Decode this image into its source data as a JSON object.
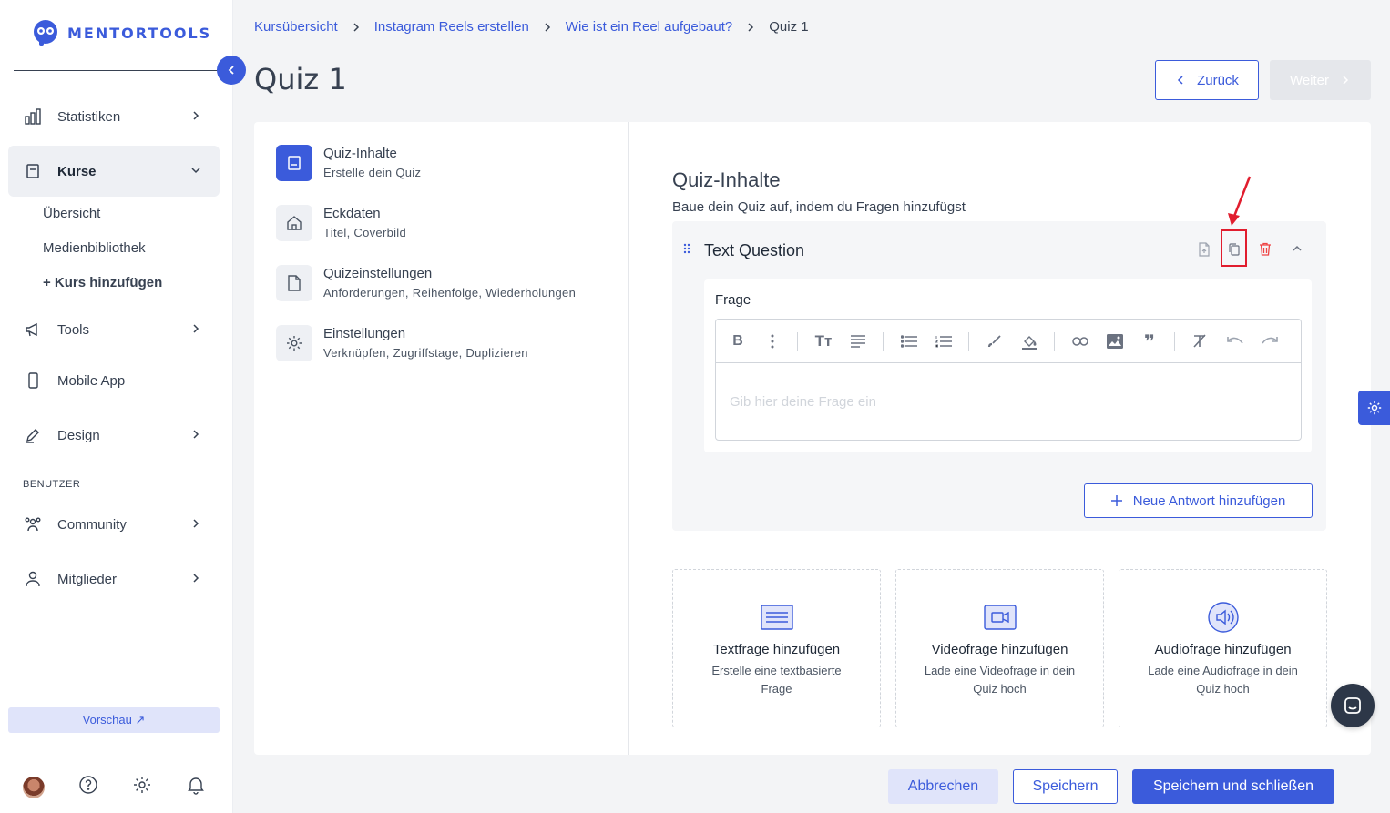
{
  "brand": {
    "name": "MENTORTOOLS",
    "accent": "#3b5bdb"
  },
  "sidebar": {
    "items": [
      {
        "label": "Statistiken",
        "icon": "bar-chart-icon"
      },
      {
        "label": "Kurse",
        "icon": "book-icon",
        "active": true
      },
      {
        "label": "Tools",
        "icon": "megaphone-icon"
      },
      {
        "label": "Mobile App",
        "icon": "phone-icon"
      },
      {
        "label": "Design",
        "icon": "pen-icon"
      },
      {
        "label": "Community",
        "icon": "people-icon"
      },
      {
        "label": "Mitglieder",
        "icon": "user-icon"
      }
    ],
    "sub_items": [
      {
        "label": "Übersicht"
      },
      {
        "label": "Medienbibliothek"
      },
      {
        "label": "+ Kurs hinzufügen"
      }
    ],
    "section_label": "BENUTZER",
    "preview_label": "Vorschau ↗"
  },
  "breadcrumb": {
    "items": [
      "Kursübersicht",
      "Instagram Reels erstellen",
      "Wie ist ein Reel aufgebaut?"
    ],
    "current": "Quiz 1"
  },
  "page": {
    "title": "Quiz 1",
    "back_label": "Zurück",
    "next_label": "Weiter"
  },
  "steps": [
    {
      "title": "Quiz-Inhalte",
      "sub": "Erstelle dein Quiz",
      "icon": "book-icon"
    },
    {
      "title": "Eckdaten",
      "sub": "Titel, Coverbild",
      "icon": "home-icon"
    },
    {
      "title": "Quizeinstellungen",
      "sub": "Anforderungen, Reihenfolge, Wiederholungen",
      "icon": "file-icon"
    },
    {
      "title": "Einstellungen",
      "sub": "Verknüpfen, Zugriffstage, Duplizieren",
      "icon": "gear-icon"
    }
  ],
  "content": {
    "title": "Quiz-Inhalte",
    "subtitle": "Baue dein Quiz auf, indem du Fragen hinzufügst",
    "question": {
      "title": "Text Question",
      "frage_label": "Frage",
      "placeholder": "Gib hier deine Frage ein",
      "new_answer_label": "Neue Antwort hinzufügen"
    },
    "add_cards": [
      {
        "title": "Textfrage hinzufügen",
        "sub": "Erstelle eine textbasierte Frage",
        "icon": "text-icon"
      },
      {
        "title": "Videofrage hinzufügen",
        "sub": "Lade eine Videofrage in dein Quiz hoch",
        "icon": "video-icon"
      },
      {
        "title": "Audiofrage hinzufügen",
        "sub": "Lade eine Audiofrage in dein Quiz hoch",
        "icon": "audio-icon"
      }
    ]
  },
  "footer": {
    "cancel": "Abbrechen",
    "save": "Speichern",
    "save_close": "Speichern und schließen"
  }
}
